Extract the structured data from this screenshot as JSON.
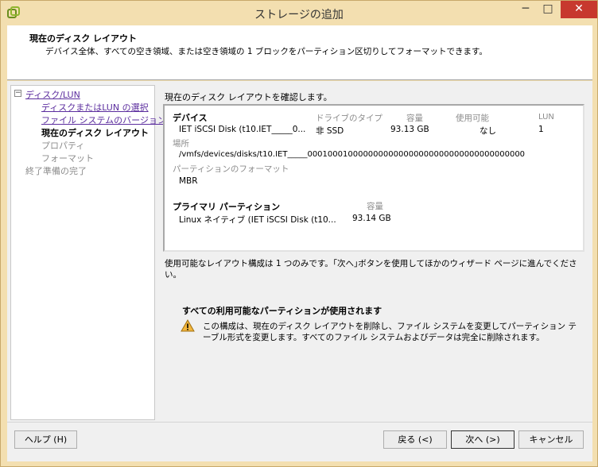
{
  "window": {
    "title": "ストレージの追加",
    "minimize": "─",
    "maximize": "□",
    "close": "✕"
  },
  "header": {
    "title": "現在のディスク レイアウト",
    "description": "デバイス全体、すべての空き領域、または空き領域の 1 ブロックをパーティション区切りしてフォーマットできます。"
  },
  "sidebar": {
    "toggle": "−",
    "items": [
      {
        "label": "ディスク/LUN",
        "state": "link"
      },
      {
        "label": "ディスクまたはLUN の選択",
        "state": "link"
      },
      {
        "label": "ファイル システムのバージョン",
        "state": "link"
      },
      {
        "label": "現在のディスク レイアウト",
        "state": "current"
      },
      {
        "label": "プロパティ",
        "state": "disabled"
      },
      {
        "label": "フォーマット",
        "state": "disabled"
      },
      {
        "label": "終了準備の完了",
        "state": "disabled"
      }
    ]
  },
  "main": {
    "heading": "現在のディスク レイアウトを確認します。",
    "device": {
      "section_label": "デバイス",
      "col_drive_type": "ドライブのタイプ",
      "col_capacity": "容量",
      "col_available": "使用可能",
      "col_lun": "LUN",
      "name": "IET iSCSI Disk (t10.IET_____0...",
      "drive_type": "非 SSD",
      "capacity": "93.13 GB",
      "available": "なし",
      "lun": "1",
      "location_label": "場所",
      "location": "/vmfs/devices/disks/t10.IET_____0001000100000000000000000000000000000000000",
      "partition_format_label": "パーティションのフォーマット",
      "partition_format": "MBR"
    },
    "primary_partition": {
      "section_label": "プライマリ パーティション",
      "col_capacity": "容量",
      "name": "Linux ネイティブ (IET iSCSI Disk (t10...",
      "capacity": "93.14 GB"
    },
    "availability_note": "使用可能なレイアウト構成は 1 つのみです。｢次へ｣ボタンを使用してほかのウィザード ページに進んでください。",
    "warning": {
      "title": "すべての利用可能なパーティションが使用されます",
      "icon": "warning-icon",
      "text": "この構成は、現在のディスク レイアウトを削除し、ファイル システムを変更してパーティション テーブル形式を変更します。すべてのファイル システムおよびデータは完全に削除されます。"
    }
  },
  "footer": {
    "help": "ヘルプ (H)",
    "back": "戻る (<)",
    "next": "次へ (>)",
    "cancel": "キャンセル"
  },
  "colors": {
    "frame": "#f3dfb0",
    "close_button": "#c7382e",
    "link": "#5b2d9e"
  }
}
